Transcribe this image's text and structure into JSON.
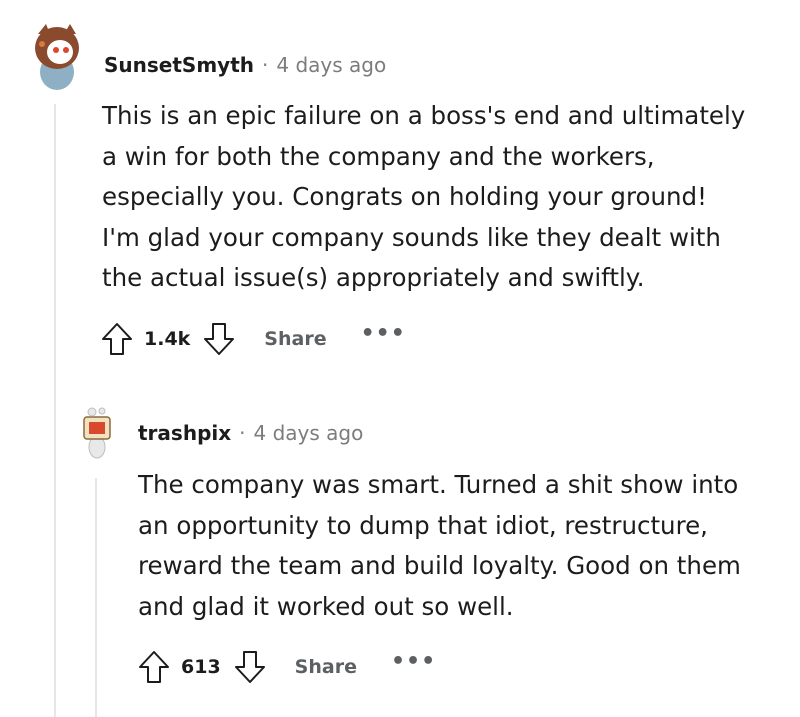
{
  "comments": [
    {
      "username": "SunsetSmyth",
      "separator": "·",
      "time": "4 days ago",
      "lines": [
        "This is an epic failure on a boss's end and ultimately",
        "a win for both the company and the workers,",
        "especially you. Congrats on holding your ground!",
        "I'm glad your company sounds like they dealt with",
        "the actual issue(s) appropriately and swiftly."
      ],
      "score": "1.4k",
      "share_label": "Share",
      "more_label": "•••"
    },
    {
      "username": "trashpix",
      "separator": "·",
      "time": "4 days ago",
      "lines": [
        "The company was smart. Turned a shit show into",
        "an opportunity to dump that idiot, restructure,",
        "reward the team and build loyalty. Good on them",
        "and glad it worked out so well."
      ],
      "score": "613",
      "share_label": "Share",
      "more_label": "•••"
    }
  ]
}
